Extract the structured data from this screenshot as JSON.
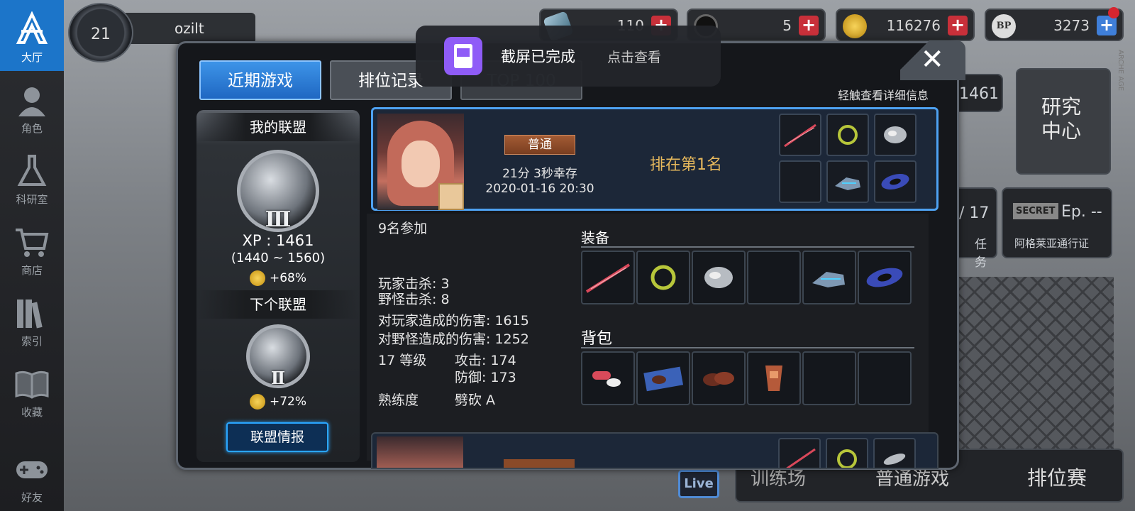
{
  "sidebar": {
    "items": [
      {
        "label": "大厅",
        "icon": "lobby-icon"
      },
      {
        "label": "角色",
        "icon": "character-icon"
      },
      {
        "label": "科研室",
        "icon": "flask-icon"
      },
      {
        "label": "商店",
        "icon": "cart-icon"
      },
      {
        "label": "索引",
        "icon": "books-icon"
      },
      {
        "label": "收藏",
        "icon": "book-open-icon"
      },
      {
        "label": "好友",
        "icon": "gamepad-icon"
      }
    ]
  },
  "player": {
    "level": "21",
    "name": "ozilt"
  },
  "resources": [
    {
      "value": "110",
      "icon": "gem-icon"
    },
    {
      "value": "5",
      "icon": "ticket-icon"
    },
    {
      "value": "116276",
      "icon": "coin-icon"
    },
    {
      "value": "3273",
      "icon": "bp-icon",
      "label": "BP"
    }
  ],
  "background": {
    "xp": "1461",
    "research_center": "研究\n中心",
    "quest_count": "/ 17",
    "quest_label": "任务",
    "secret_label": "SECRET",
    "episode": "Ep. --",
    "pass_label": "阿格莱亚通行证",
    "live_label": "Live",
    "training_label": "训练场",
    "normal_game_label": "普通游戏",
    "ranked_label": "排位赛",
    "vertical_text": "ARCHE AGE"
  },
  "toast": {
    "title": "截屏已完成",
    "action": "点击查看"
  },
  "modal": {
    "tabs": [
      {
        "label": "近期游戏",
        "active": true
      },
      {
        "label": "排位记录",
        "active": false
      },
      {
        "label": "TOP 100",
        "active": false
      }
    ],
    "close_label": "✕",
    "hint": "轻触查看详细信息",
    "league": {
      "my_title": "我的联盟",
      "my_tier": "Ⅲ",
      "xp": "XP : 1461",
      "range": "(1440 ~ 1560)",
      "my_bonus": "+68%",
      "next_title": "下个联盟",
      "next_tier": "Ⅱ",
      "next_bonus": "+72%",
      "info_button": "联盟情报"
    },
    "match": {
      "mode": "普通",
      "survive": "21分 3秒幸存",
      "datetime": "2020-01-16 20:30",
      "rank": "排在第1名",
      "items": [
        "sword-icon",
        "ring-icon",
        "disc-icon",
        "empty",
        "gauntlet-icon",
        "galaxy-icon"
      ]
    },
    "details": {
      "participants": "9名参加",
      "player_kills": "玩家击杀: 3",
      "monster_kills": "野怪击杀: 8",
      "player_damage": "对玩家造成的伤害: 1615",
      "monster_damage": "对野怪造成的伤害: 1252",
      "level": "17 等级",
      "attack": "攻击: 174",
      "defense": "防御: 173",
      "proficiency_label": "熟练度",
      "proficiency_value": "劈砍 A",
      "equipment_title": "装备",
      "equipment": [
        "sword-icon",
        "ring-icon",
        "disc-icon",
        "empty",
        "gauntlet-icon",
        "galaxy-icon"
      ],
      "backpack_title": "背包",
      "backpack": [
        "pills-icon",
        "cookie-box-icon",
        "cookies-icon",
        "drink-icon",
        "empty",
        "empty"
      ]
    },
    "match2": {
      "items": [
        "sword-icon",
        "ring-icon",
        "disc-icon"
      ]
    }
  }
}
